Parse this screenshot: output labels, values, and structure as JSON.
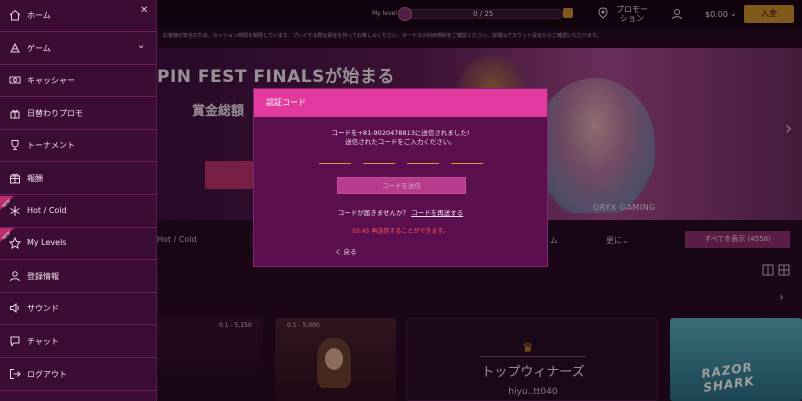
{
  "header": {
    "level_label": "My level",
    "level_progress": "0 / 25",
    "promotions_label": "プロモー\nション",
    "balance": "$0.00",
    "deposit_label": "入金"
  },
  "notice_text": "お客様の安全のため、セッション時間を制限しています。プレイする際は責任を持ってお楽しみください。ボーナスの利用規約をご確認ください。詳細はアカウント設定からご確認いただけます。",
  "hero": {
    "title": "PIN FEST FINALSが始まる",
    "subtitle": "賞金総額",
    "provider": "ORYX GAMING"
  },
  "categories": {
    "hot_cold": "Hot / Cold",
    "game": "ム",
    "more": "更に",
    "show_all": "すべてを表示 (4558)"
  },
  "cards": {
    "limit1": "0.1 - 5,150",
    "limit2": "0.1 - 5,000",
    "winners_title": "トップウィナーズ",
    "winners_name": "hiyu..tt040",
    "card4_title": "RAZOR SHARK"
  },
  "sidebar": {
    "items": [
      {
        "label": "ホーム",
        "icon": "home-icon"
      },
      {
        "label": "ゲーム",
        "icon": "game-icon"
      },
      {
        "label": "キャッシャー",
        "icon": "cashier-icon"
      },
      {
        "label": "日替わりプロモ",
        "icon": "promo-icon"
      },
      {
        "label": "トーナメント",
        "icon": "trophy-icon"
      },
      {
        "label": "報酬",
        "icon": "rewards-icon"
      },
      {
        "label": "Hot / Cold",
        "icon": "hotcold-icon",
        "badge": "NEW"
      },
      {
        "label": "My Levels",
        "icon": "levels-icon",
        "badge": "NEW"
      },
      {
        "label": "登録情報",
        "icon": "profile-icon"
      },
      {
        "label": "サウンド",
        "icon": "sound-icon"
      },
      {
        "label": "チャット",
        "icon": "chat-icon"
      },
      {
        "label": "ログアウト",
        "icon": "logout-icon"
      }
    ]
  },
  "modal": {
    "title": "認証コード",
    "message_line1": "コードを+81-9020478813に送信されました!",
    "message_line2": "送信されたコードをご入力ください。",
    "confirm_label": "コードを送信",
    "resend_prompt": "コードが届きませんか？",
    "resend_link": "コードを再送する",
    "resend_timer": "03:45 再送信することができます。",
    "back_label": "く 戻る"
  },
  "colors": {
    "modal_header": "#e23a9e",
    "modal_body": "#5c0f4e",
    "sidebar_bg": "#3c0d34",
    "accent_gold": "#c58a2a",
    "error_red": "#ff5a5a"
  }
}
